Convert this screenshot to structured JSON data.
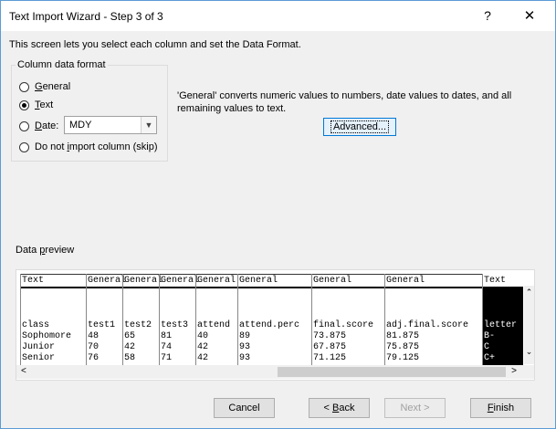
{
  "window": {
    "title": "Text Import Wizard - Step 3 of 3",
    "help": "?",
    "close": "✕"
  },
  "intro": "This screen lets you select each column and set the Data Format.",
  "format_group": {
    "label": "Column data format",
    "options": [
      {
        "pre": "",
        "u": "G",
        "post": "eneral",
        "checked": false
      },
      {
        "pre": "",
        "u": "T",
        "post": "ext",
        "checked": true
      },
      {
        "pre": "",
        "u": "D",
        "post": "ate:",
        "checked": false
      },
      {
        "pre": "Do not ",
        "u": "i",
        "post": "mport column (skip)",
        "checked": false
      }
    ],
    "date_value": "MDY"
  },
  "description": "'General' converts numeric values to numbers, date values to dates, and all remaining values to text.",
  "advanced_label": "Advanced...",
  "preview": {
    "label_pre": "Data ",
    "label_u": "p",
    "label_post": "review",
    "columns": [
      {
        "header": "Text",
        "rows": [
          "class",
          "Sophomore",
          "Junior",
          "Senior"
        ]
      },
      {
        "header": "General",
        "rows": [
          "test1",
          "48",
          "70",
          "76"
        ]
      },
      {
        "header": "General",
        "rows": [
          "test2",
          "65",
          "42",
          "58"
        ]
      },
      {
        "header": "General",
        "rows": [
          "test3",
          "81",
          "74",
          "71"
        ]
      },
      {
        "header": "General",
        "rows": [
          "attend",
          "40",
          "42",
          "42"
        ]
      },
      {
        "header": "General",
        "rows": [
          "attend.perc",
          "89",
          "93",
          "93"
        ]
      },
      {
        "header": "General",
        "rows": [
          "final.score",
          "73.875",
          "67.875",
          "71.125"
        ]
      },
      {
        "header": "General",
        "rows": [
          "adj.final.score",
          "81.875",
          "75.875",
          "79.125"
        ]
      },
      {
        "header": "Text",
        "rows": [
          "letter",
          "B-",
          "C",
          "C+"
        ]
      }
    ]
  },
  "buttons": {
    "cancel": "Cancel",
    "back_pre": "< ",
    "back_u": "B",
    "back_post": "ack",
    "next": "Next >",
    "finish_u": "F",
    "finish_post": "inish"
  }
}
